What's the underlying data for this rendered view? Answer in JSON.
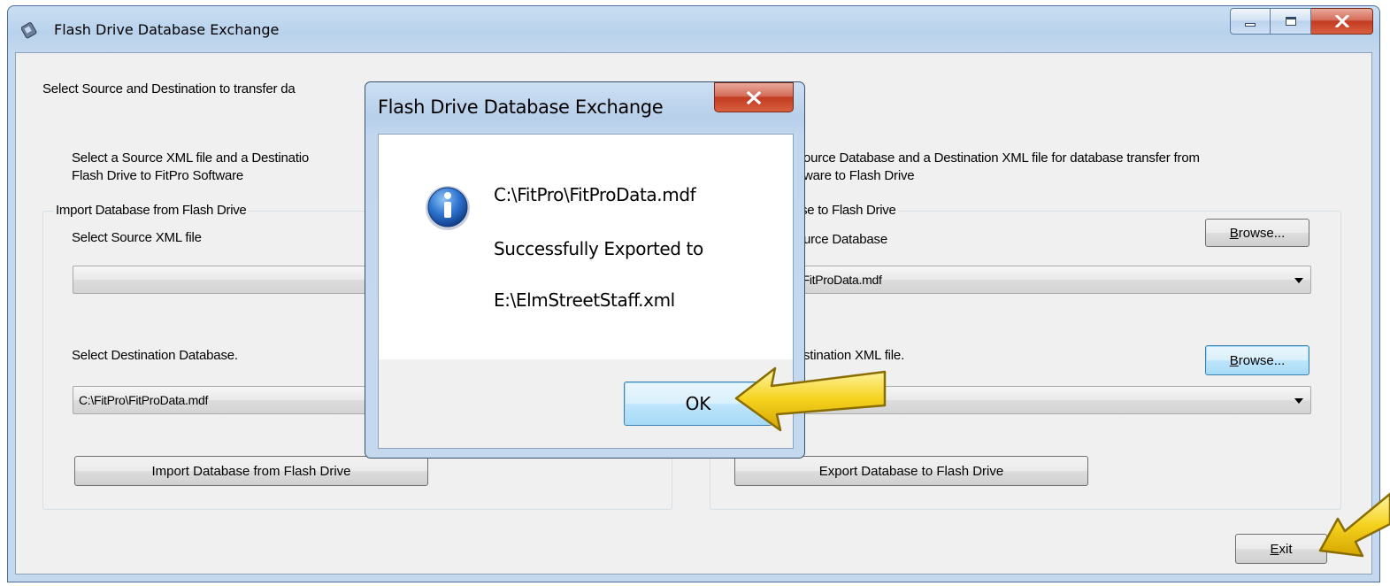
{
  "window": {
    "title": "Flash Drive Database Exchange",
    "min_icon": "minimize-icon",
    "max_icon": "maximize-icon",
    "close_icon": "close-icon"
  },
  "main": {
    "instruction": "Select Source and Destination to transfer da",
    "import_panel": {
      "description_line1": "Select a Source XML file and a Destinatio",
      "description_line2": "Flash Drive to FitPro Software",
      "group_title": "Import Database from Flash Drive",
      "source_label": "Select Source XML file",
      "source_value": "",
      "dest_label": "Select Destination Database.",
      "dest_value": "C:\\FitPro\\FitProData.mdf",
      "import_button": "Import Database from Flash Drive"
    },
    "export_panel": {
      "description_line1": "ource Database and a Destination XML file for database transfer from",
      "description_line2": "ware to Flash Drive",
      "group_title": "base to Flash Drive",
      "source_label": "urce Database",
      "source_value": "\\FitProData.mdf",
      "browse_button_1": "rowse...",
      "browse_button_1_mnemonic": "B",
      "dest_label": "stination XML file.",
      "dest_value": "",
      "browse_button_2": "rowse...",
      "browse_button_2_mnemonic": "B",
      "export_button": "Export  Database to Flash Drive"
    },
    "exit_button": "xit",
    "exit_button_mnemonic": "E"
  },
  "dialog": {
    "title": "Flash Drive Database Exchange",
    "icon": "info-icon",
    "line1": "C:\\FitPro\\FitProData.mdf",
    "line2": "Successfully Exported to",
    "line3": "E:\\ElmStreetStaff.xml",
    "ok_button": "OK"
  },
  "annotations": {
    "arrow_color": "#f5d21e",
    "arrow_outline": "#8a6d00"
  }
}
